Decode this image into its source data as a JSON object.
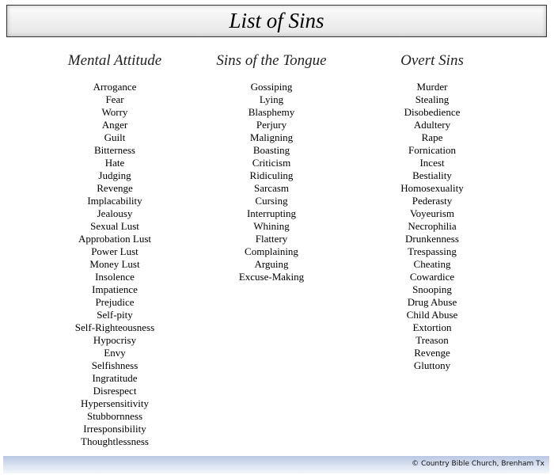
{
  "title": "List of Sins",
  "columns": [
    {
      "heading": "Mental Attitude",
      "items": [
        "Arrogance",
        "Fear",
        "Worry",
        "Anger",
        "Guilt",
        "Bitterness",
        "Hate",
        "Judging",
        "Revenge",
        "Implacability",
        "Jealousy",
        "Sexual Lust",
        "Approbation Lust",
        "Power Lust",
        "Money Lust",
        "Insolence",
        "Impatience",
        "Prejudice",
        "Self-pity",
        "Self-Righteousness",
        "Hypocrisy",
        "Envy",
        "Selfishness",
        "Ingratitude",
        "Disrespect",
        "Hypersensitivity",
        "Stubbornness",
        "Irresponsibility",
        "Thoughtlessness"
      ]
    },
    {
      "heading": "Sins of the Tongue",
      "items": [
        "Gossiping",
        "Lying",
        "Blasphemy",
        "Perjury",
        "Maligning",
        "Boasting",
        "Criticism",
        "Ridiculing",
        "Sarcasm",
        "Cursing",
        "Interrupting",
        "Whining",
        "Flattery",
        "Complaining",
        "Arguing",
        "Excuse-Making"
      ]
    },
    {
      "heading": "Overt Sins",
      "items": [
        "Murder",
        "Stealing",
        "Disobedience",
        "Adultery",
        "Rape",
        "Fornication",
        "Incest",
        "Bestiality",
        "Homosexuality",
        "Pederasty",
        "Voyeurism",
        "Necrophilia",
        "Drunkenness",
        "Trespassing",
        "Cheating",
        "Cowardice",
        "Snooping",
        "Drug Abuse",
        "Child Abuse",
        "Extortion",
        "Treason",
        "Revenge",
        "Gluttony"
      ]
    }
  ],
  "footer": "© Country Bible Church, Brenham Tx"
}
